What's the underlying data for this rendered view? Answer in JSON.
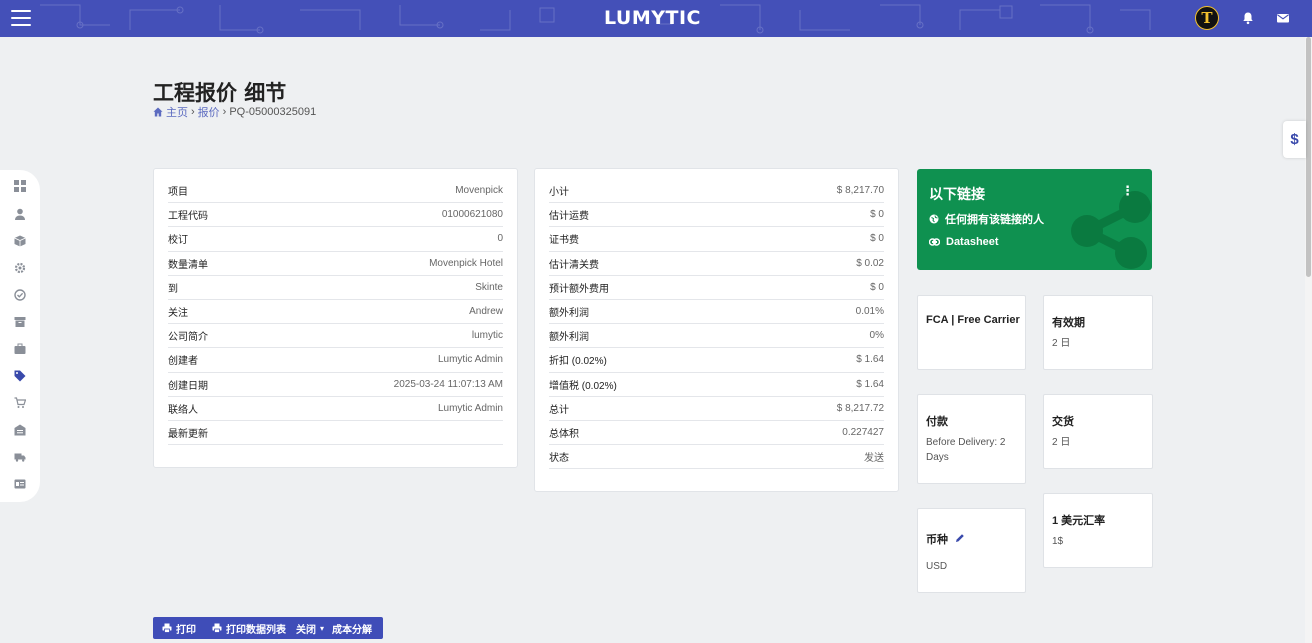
{
  "app": {
    "logo_text": "LUMYTIC",
    "avatar_letter": "T"
  },
  "icons": {
    "menu": "hamburger-icon",
    "bell": "bell-icon",
    "mail": "mail-icon",
    "dollar": "dollar-icon",
    "home": "home-icon",
    "globe": "globe-icon",
    "link": "link-icon",
    "share": "share-icon",
    "edit": "pencil-icon",
    "print": "printer-icon"
  },
  "colors": {
    "header": "#4450b8",
    "accent": "#3949ab",
    "share_card": "#0f9150",
    "action_bar": "#3f4db8"
  },
  "dollar_tab": "$",
  "sidenav": [
    {
      "name": "dashboard-icon"
    },
    {
      "name": "user-icon"
    },
    {
      "name": "box-icon"
    },
    {
      "name": "cog-icon"
    },
    {
      "name": "check-circle-icon"
    },
    {
      "name": "archive-icon"
    },
    {
      "name": "briefcase-icon"
    },
    {
      "name": "tag-icon",
      "active": true
    },
    {
      "name": "cart-icon"
    },
    {
      "name": "warehouse-icon"
    },
    {
      "name": "truck-icon"
    },
    {
      "name": "id-card-icon"
    }
  ],
  "page": {
    "title": "工程报价 细节",
    "breadcrumb": {
      "home": "主页",
      "sep1": "›",
      "quotes": "报价",
      "sep2": "›",
      "current": "PQ-05000325091"
    }
  },
  "details": [
    {
      "k": "项目",
      "v": "Movenpick"
    },
    {
      "k": "工程代码",
      "v": "01000621080"
    },
    {
      "k": "校订",
      "v": "0"
    },
    {
      "k": "数量清单",
      "v": "Movenpick Hotel"
    },
    {
      "k": "到",
      "v": "Skinte"
    },
    {
      "k": "关注",
      "v": "Andrew"
    },
    {
      "k": "公司简介",
      "v": "lumytic"
    },
    {
      "k": "创建者",
      "v": "Lumytic Admin"
    },
    {
      "k": "创建日期",
      "v": "2025-03-24 11:07:13 AM"
    },
    {
      "k": "联络人",
      "v": "Lumytic Admin"
    },
    {
      "k": "最新更新",
      "v": ""
    }
  ],
  "totals": [
    {
      "k": "小计",
      "v": "$ 8,217.70"
    },
    {
      "k": "估计运费",
      "v": "$ 0"
    },
    {
      "k": "证书费",
      "v": "$ 0"
    },
    {
      "k": "估计清关费",
      "v": "$ 0.02"
    },
    {
      "k": "预计额外费用",
      "v": "$ 0"
    },
    {
      "k": "额外利润",
      "v": "0.01%"
    },
    {
      "k": "额外利润",
      "v": "0%"
    },
    {
      "k": "折扣 (0.02%)",
      "v": "$ 1.64"
    },
    {
      "k": "增值税 (0.02%)",
      "v": "$ 1.64"
    },
    {
      "k": "总计",
      "v": "$ 8,217.72"
    },
    {
      "k": "总体积",
      "v": "0.227427"
    },
    {
      "k": "状态",
      "v": "发送"
    }
  ],
  "share": {
    "title": "以下链接",
    "kebab": "⋮",
    "access": "任何拥有该链接的人",
    "datasheet": "Datasheet"
  },
  "info_cards": {
    "incoterm": {
      "label": "FCA | Free Carrier"
    },
    "validity": {
      "label": "有效期",
      "value": "2 日"
    },
    "payment": {
      "label": "付款",
      "value": "Before Delivery: 2 Days"
    },
    "delivery": {
      "label": "交货",
      "value": "2 日"
    },
    "currency": {
      "label": "币种",
      "value": "USD"
    },
    "rate": {
      "label": "1 美元汇率",
      "value": "1$"
    }
  },
  "actions": {
    "print": "打印",
    "print_datasheet": "打印数据列表",
    "close": "关闭",
    "close_caret": "▾",
    "cost_breakdown": "成本分解"
  }
}
